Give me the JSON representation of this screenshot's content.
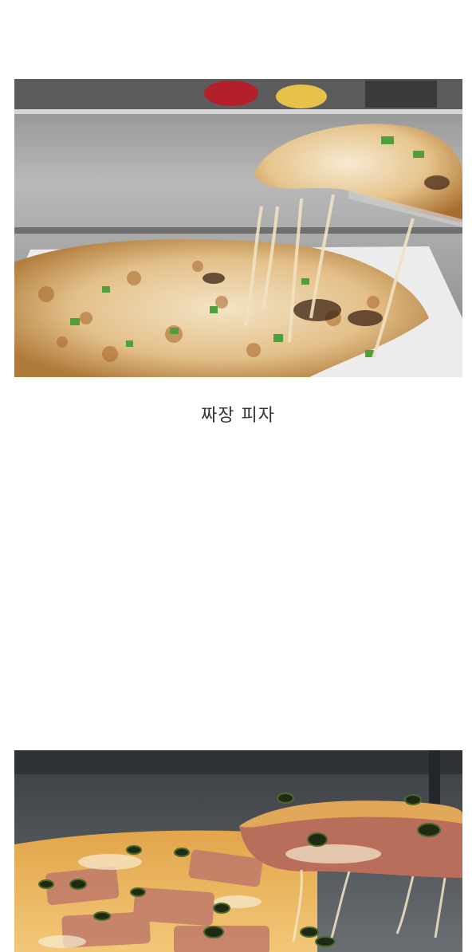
{
  "post": {
    "caption_1": "짜장 피자"
  },
  "images": [
    {
      "name": "jjajang-pizza-photo",
      "alt": ""
    },
    {
      "name": "ham-pizza-photo",
      "alt": ""
    }
  ]
}
